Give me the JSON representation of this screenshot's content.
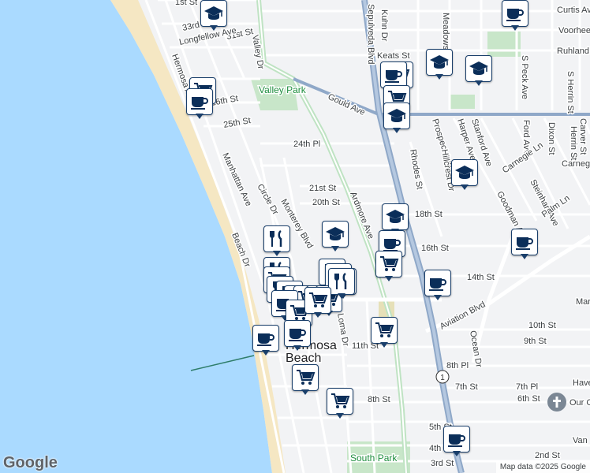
{
  "streets": [
    "1st St",
    "33rd St",
    "31st St",
    "Longfellow Ave",
    "Curtis Ave",
    "Voorhees Ave",
    "Ruhland Ave",
    "Keats St",
    "Meadows Ave",
    "Kuhn Dr",
    "Sepulveda Blvd",
    "Valley Dr",
    "Hermosa Ave",
    "Manhattan Ave",
    "26th St",
    "25th St",
    "Valley Park",
    "Gould Ave",
    "24th Pl",
    "Prospect Ave",
    "Harper Ave",
    "Stanford Ave",
    "Ford Ave",
    "S Peck Ave",
    "S Herrin St",
    "Carver St",
    "Dixon St",
    "Herrin St",
    "Carnegie Ln",
    "Carneg",
    "Steinhart Ave",
    "Goodman Ave",
    "Palm Ln",
    "21st St",
    "20th St",
    "Rhodes St",
    "Hillcrest Dr",
    "18th St",
    "16th St",
    "14th St",
    "Loma Dr",
    "Circle Dr",
    "Monterey Blvd",
    "Ardmore Ave",
    "Beach Dr",
    "Aviation Blvd",
    "Marsha",
    "10th St",
    "9th St",
    "11th St",
    "8th Pl",
    "7th St",
    "7th Pl",
    "6th St",
    "8th St",
    "5th St",
    "4th St",
    "3rd St",
    "2nd St",
    "Van",
    "Have",
    "Ocean Dr",
    "South Park"
  ],
  "city_label": "Hermosa Beach",
  "highway_shield": "1",
  "church_label": "Our Chur",
  "attribution": "Map data ©2025 Google",
  "logo": "Google",
  "pin_icons": [
    "coffee-cup-icon",
    "shopping-cart-icon",
    "graduation-cap-icon",
    "fork-knife-icon"
  ],
  "colors": {
    "ocean": "#aadaff",
    "beach": "#f5e7c3",
    "land": "#f2f3f5",
    "park": "#c8e6c9",
    "highway": "#8fa8c8",
    "pin_border": "#1a3f6b"
  }
}
